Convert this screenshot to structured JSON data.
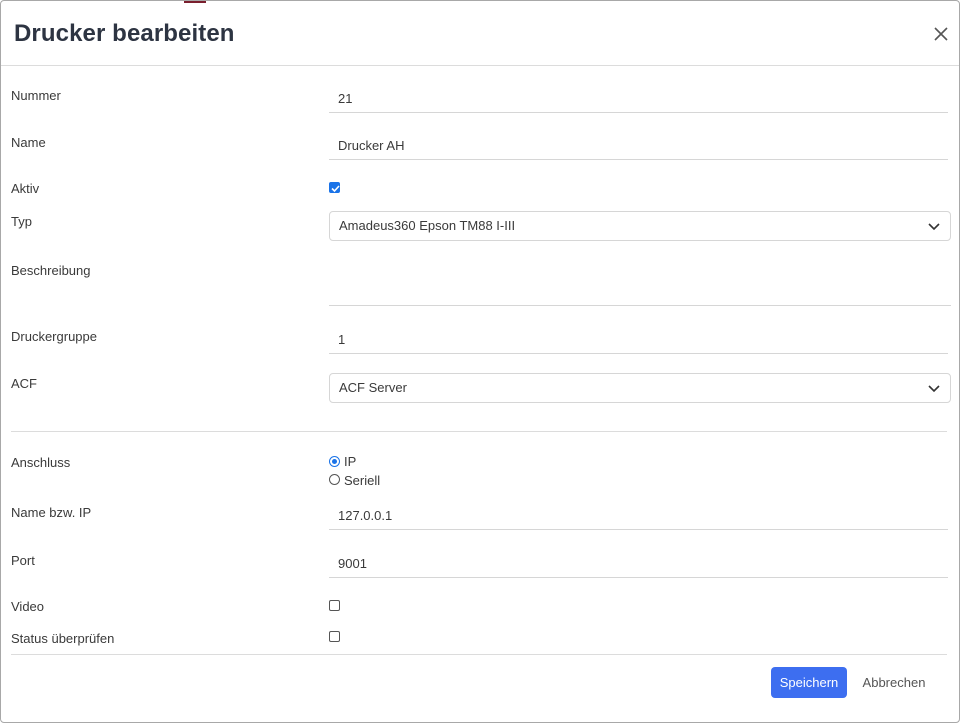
{
  "dialog": {
    "title": "Drucker bearbeiten"
  },
  "fields": {
    "nummer": {
      "label": "Nummer",
      "value": "21"
    },
    "name": {
      "label": "Name",
      "value": "Drucker AH"
    },
    "aktiv": {
      "label": "Aktiv",
      "checked": true
    },
    "typ": {
      "label": "Typ",
      "value": "Amadeus360 Epson TM88 I-III"
    },
    "beschreibung": {
      "label": "Beschreibung",
      "value": ""
    },
    "druckergruppe": {
      "label": "Druckergruppe",
      "value": "1"
    },
    "acf": {
      "label": "ACF",
      "value": "ACF Server"
    },
    "anschluss": {
      "label": "Anschluss",
      "options": [
        "IP",
        "Seriell"
      ],
      "selected": "IP"
    },
    "name_ip": {
      "label": "Name bzw. IP",
      "value": "127.0.0.1"
    },
    "port": {
      "label": "Port",
      "value": "9001"
    },
    "video": {
      "label": "Video",
      "checked": false
    },
    "status": {
      "label": "Status überprüfen",
      "checked": false
    }
  },
  "footer": {
    "save_label": "Speichern",
    "cancel_label": "Abbrechen"
  },
  "colors": {
    "primary": "#3d6ef0",
    "checkbox": "#1a73e8",
    "title": "#2d3442"
  }
}
